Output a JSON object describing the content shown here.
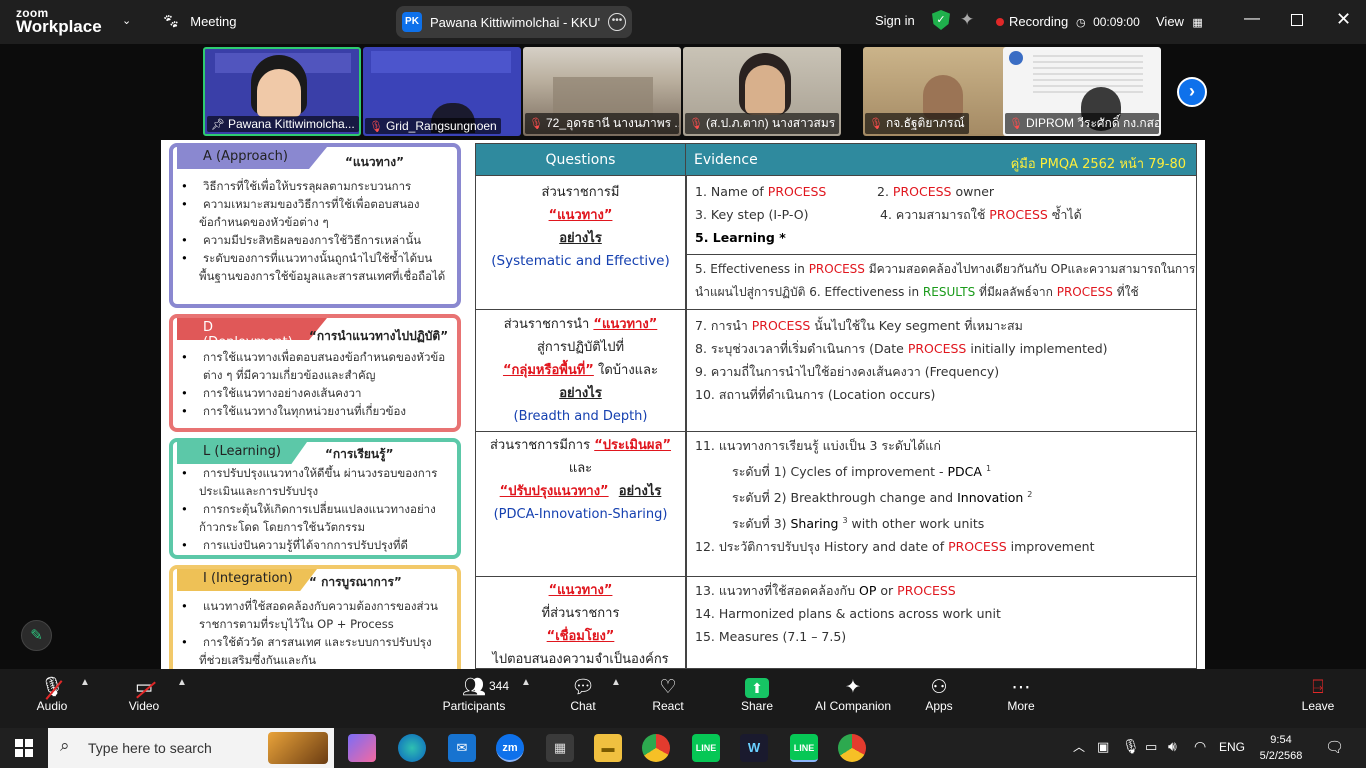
{
  "titlebar": {
    "logo_line1": "zoom",
    "logo_line2": "Workplace",
    "meeting_label": "Meeting",
    "host_initials": "PK",
    "meeting_title": "Pawana Kittiwimolchai - KKU's sc",
    "sign_in": "Sign in",
    "recording": "Recording",
    "timer": "00:09:00",
    "view": "View"
  },
  "participants_strip": [
    {
      "name": "Pawana Kittiwimolcha..."
    },
    {
      "name": "Grid_Rangsungnoen"
    },
    {
      "name": "72_อุดรธานี นางนภาพร ..."
    },
    {
      "name": "(ส.ป.ภ.ตาก) นางสาวสมร ..."
    },
    {
      "name": "กจ.ธัฐติยาภรณ์"
    },
    {
      "name": "DIPROM วีระศักดิ์ กง.กสอ."
    }
  ],
  "slide": {
    "left_boxes": [
      {
        "header": "A (Approach)",
        "title": "“แนวทาง”",
        "color": "#8a88d0",
        "items": [
          {
            "t": "วิธีการที่ใช้เพื่อให้บรรลุผลตามกระบวนการ",
            "b": true
          },
          {
            "t": "ความเหมาะสมของวิธีการที่ใช้เพื่อตอบสนอง",
            "b": true
          },
          {
            "t": "ข้อกำหนดของหัวข้อต่าง ๆ",
            "b": false
          },
          {
            "t": "ความมีประสิทธิผลของการใช้วิธีการเหล่านั้น",
            "b": true
          },
          {
            "t": "ระดับของการที่แนวทางนั้นถูกนำไปใช้ซ้ำได้บน",
            "b": true
          },
          {
            "t": "พื้นฐานของการใช้ข้อมูลและสารสนเทศที่เชื่อถือได้",
            "b": false
          }
        ]
      },
      {
        "header": "D (Deployment)",
        "title": "“การนำแนวทางไปปฏิบัติ”",
        "color": "#e87373",
        "items": [
          {
            "t": "การใช้แนวทางเพื่อตอบสนองข้อกำหนดของหัวข้อ",
            "b": true
          },
          {
            "t": "ต่าง ๆ ที่มีความเกี่ยวข้องและสำคัญ",
            "b": false
          },
          {
            "t": "การใช้แนวทางอย่างคงเส้นคงวา",
            "b": true
          },
          {
            "t": "การใช้แนวทางในทุกหน่วยงานที่เกี่ยวข้อง",
            "b": true
          }
        ]
      },
      {
        "header": "L (Learning)",
        "title": "“การเรียนรู้”",
        "color": "#5cc8a8",
        "items": [
          {
            "t": "การปรับปรุงแนวทางให้ดีขึ้น ผ่านวงรอบของการ",
            "b": true
          },
          {
            "t": "ประเมินและการปรับปรุง",
            "b": false
          },
          {
            "t": "การกระตุ้นให้เกิดการเปลี่ยนแปลงแนวทางอย่าง",
            "b": true
          },
          {
            "t": "ก้าวกระโดด โดยการใช้นวัตกรรม",
            "b": false
          },
          {
            "t": "การแบ่งปันความรู้ที่ได้จากการปรับปรุงที่ดี",
            "b": true
          }
        ]
      },
      {
        "header": "I (Integration)",
        "title": "“ การบูรณาการ”",
        "color": "#f2c96a",
        "items": [
          {
            "t": "แนวทางที่ใช้สอดคล้องกับความต้องการของส่วน",
            "b": true
          },
          {
            "t": "ราชการตามที่ระบุไว้ใน OP + Process",
            "b": false
          },
          {
            "t": "การใช้ตัววัด สารสนเทศ และระบบการปรับปรุง",
            "b": true
          },
          {
            "t": "ที่ช่วยเสริมซึ่งกันและกัน",
            "b": false
          }
        ]
      }
    ],
    "table": {
      "col_questions": "Questions",
      "col_evidence": "Evidence",
      "manual_ref": "คู่มือ PMQA 2562   หน้า 79-80",
      "rows": {
        "a": {
          "q1": "ส่วนราชการมี",
          "q2": "“แนวทาง”",
          "q3": "อย่างไร",
          "q4": "(Systematic and Effective)",
          "e1a": "1. Name of ",
          "e1b": "PROCESS",
          "e2a": "2. ",
          "e2b": "PROCESS",
          "e2c": " owner",
          "e3": "3. Key step (I-P-O)",
          "e4a": "4. ความสามารถใช้ ",
          "e4b": "PROCESS",
          "e4c": " ซ้ำได้",
          "e5": "5. Learning *",
          "e6a": "5. Effectiveness in ",
          "e6b": "PROCESS",
          "e6c": " มีความสอดคล้องไปทางเดียวกันกับ OPและความสามารถในการ",
          "e7a": "นำแผนไปสู่การปฏิบัติ  6. Effectiveness in ",
          "e7b": "RESULTS",
          "e7c": " ที่มีผลลัพธ์จาก ",
          "e7d": "PROCESS",
          "e7e": " ที่ใช้"
        },
        "d": {
          "q1": "ส่วนราชการนำ ",
          "q2": "“แนวทาง”",
          "q3": "สู่การปฏิบัติไปที่",
          "q4": "“กลุ่มหรือพื้นที่”",
          "q5": " ใดบ้างและ",
          "q6": "อย่างไร",
          "q7": "(Breadth and Depth)",
          "e1a": "7. การนำ ",
          "e1b": "PROCESS",
          "e1c": " นั้นไปใช้ใน Key segment ที่เหมาะสม",
          "e2a": "8. ระบุช่วงเวลาที่เริ่มดำเนินการ (Date ",
          "e2b": "PROCESS",
          "e2c": " initially implemented)",
          "e3": "9. ความถี่ในการนำไปใช้อย่างคงเส้นคงวา (Frequency)",
          "e4": "10. สถานที่ที่ดำเนินการ (Location occurs)"
        },
        "l": {
          "q1": "ส่วนราชการมีการ ",
          "q2": "“ประเมินผล”",
          "q3": "และ",
          "q4": "“ปรับปรุงแนวทาง”",
          "q5": "อย่างไร",
          "q6": "(PDCA-Innovation-Sharing)",
          "e1": "11. แนวทางการเรียนรู้ แบ่งเป็น 3 ระดับได้แก่",
          "e2a": "ระดับที่ 1) Cycles of improvement - ",
          "e2b": "PDCA",
          "e2c": "1",
          "e3a": "ระดับที่ 2) Breakthrough change and ",
          "e3b": "Innovation",
          "e3c": "2",
          "e4a": "ระดับที่ 3) ",
          "e4b": "Sharing",
          "e4c": "3",
          "e4d": " with other work units",
          "e5a": "12. ประวัติการปรับปรุง History and date of ",
          "e5b": "PROCESS",
          "e5c": " improvement"
        },
        "i": {
          "q1": "“แนวทาง”",
          "q2": "ที่ส่วนราชการ",
          "q3": "“เชื่อมโยง”",
          "q4": "ไปตอบสนองความจำเป็นองค์กร",
          "e1a": "13. แนวทางที่ใช้สอดคล้องกับ ",
          "e1b": "OP",
          "e1c": " or ",
          "e1d": "PROCESS",
          "e2": "14. Harmonized plans & actions across work unit",
          "e3": "15. Measures (7.1 – 7.5)"
        }
      }
    }
  },
  "toolbar": {
    "audio": "Audio",
    "video": "Video",
    "participants": "Participants",
    "participant_count": "344",
    "chat": "Chat",
    "react": "React",
    "share": "Share",
    "ai": "AI Companion",
    "apps": "Apps",
    "more": "More",
    "leave": "Leave"
  },
  "taskbar": {
    "search_placeholder": "Type here to search",
    "lang": "ENG",
    "time": "9:54",
    "date": "5/2/2568"
  },
  "colors": {
    "accent": "#0e71eb",
    "record": "#e02828",
    "share_green": "#16c464",
    "table_header": "#2f8a9e",
    "process_red": "#e0161e"
  }
}
